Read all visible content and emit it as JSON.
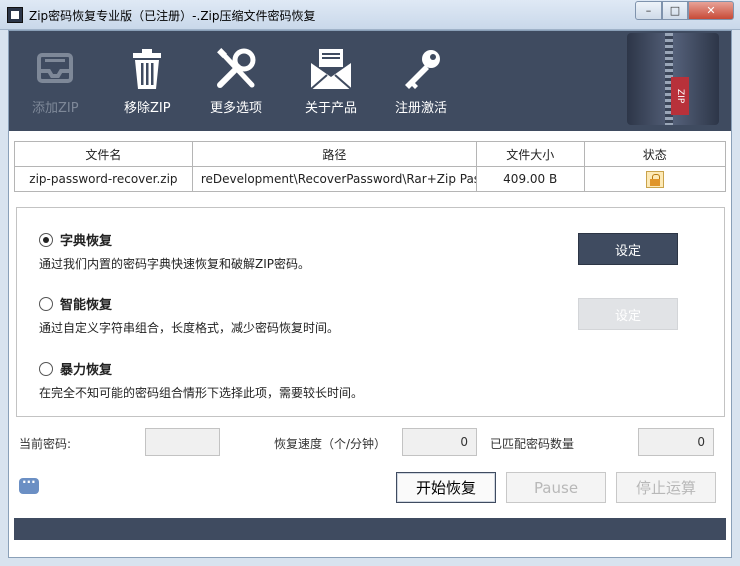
{
  "window": {
    "title": "Zip密码恢复专业版（已注册）-.Zip压缩文件密码恢复",
    "minimize": "–",
    "maximize": "□",
    "close": "✕"
  },
  "toolbar": {
    "items": [
      {
        "label": "添加ZIP",
        "icon": "inbox-tray-icon",
        "enabled": false
      },
      {
        "label": "移除ZIP",
        "icon": "trash-icon",
        "enabled": true
      },
      {
        "label": "更多选项",
        "icon": "tools-icon",
        "enabled": true
      },
      {
        "label": "关于产品",
        "icon": "envelope-icon",
        "enabled": true
      },
      {
        "label": "注册激活",
        "icon": "key-icon",
        "enabled": true
      }
    ],
    "zip_tag": "ZIP"
  },
  "file_table": {
    "headers": [
      "文件名",
      "路径",
      "文件大小",
      "状态"
    ],
    "rows": [
      {
        "name": "zip-password-recover.zip",
        "path": "reDevelopment\\RecoverPassword\\Rar+Zip Passwor",
        "size": "409.00 B",
        "status_icon": "lock-icon"
      }
    ]
  },
  "options": {
    "dictionary": {
      "label": "字典恢复",
      "desc": "通过我们内置的密码字典快速恢复和破解ZIP密码。",
      "selected": true,
      "button": "设定"
    },
    "smart": {
      "label": "智能恢复",
      "desc": "通过自定义字符串组合，长度格式，减少密码恢复时间。",
      "selected": false,
      "button": "设定"
    },
    "brute": {
      "label": "暴力恢复",
      "desc": "在完全不知可能的密码组合情形下选择此项，需要较长时间。",
      "selected": false
    }
  },
  "status": {
    "current_password_label": "当前密码:",
    "current_password": "",
    "speed_label": "恢复速度（个/分钟）",
    "speed": "0",
    "matched_label": "已匹配密码数量",
    "matched": "0"
  },
  "actions": {
    "start": "开始恢复",
    "pause": "Pause",
    "stop": "停止运算"
  },
  "colors": {
    "toolbar_bg": "#3f4b60",
    "accent": "#3f4b60"
  }
}
